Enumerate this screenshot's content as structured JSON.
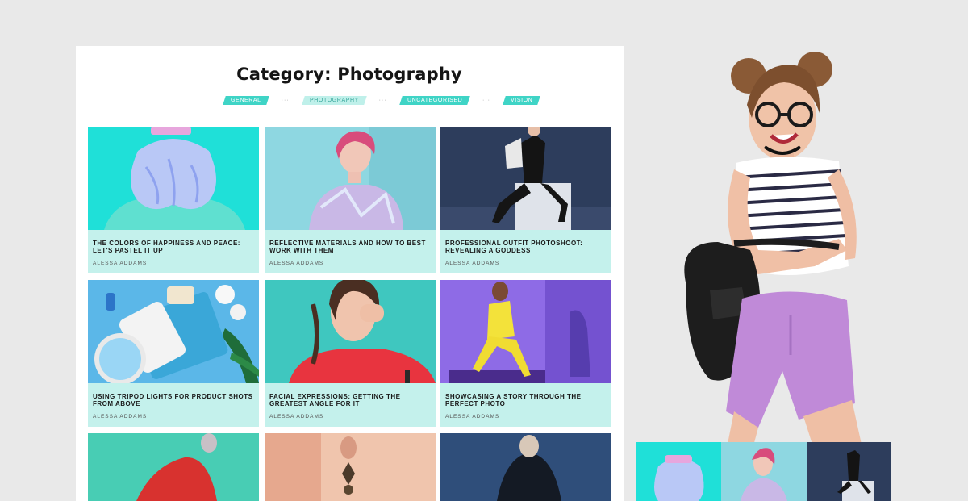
{
  "page": {
    "title": "Category: Photography"
  },
  "categories": [
    {
      "label": "GENERAL",
      "active": false
    },
    {
      "label": "PHOTOGRAPHY",
      "active": true
    },
    {
      "label": "UNCATEGORISED",
      "active": false
    },
    {
      "label": "VISION",
      "active": false
    }
  ],
  "separator": "···",
  "posts": [
    {
      "title": "THE COLORS OF HAPPINESS AND PEACE: LET'S PASTEL IT UP",
      "author": "ALESSA ADDAMS"
    },
    {
      "title": "REFLECTIVE MATERIALS AND HOW TO BEST WORK WITH THEM",
      "author": "ALESSA ADDAMS"
    },
    {
      "title": "PROFESSIONAL OUTFIT PHOTOSHOOT: REVEALING A GODDESS",
      "author": "ALESSA ADDAMS"
    },
    {
      "title": "USING TRIPOD LIGHTS FOR PRODUCT SHOTS FROM ABOVE",
      "author": "ALESSA ADDAMS"
    },
    {
      "title": "FACIAL EXPRESSIONS: GETTING THE GREATEST ANGLE FOR IT",
      "author": "ALESSA ADDAMS"
    },
    {
      "title": "SHOWCASING A STORY THROUGH THE PERFECT PHOTO",
      "author": "ALESSA ADDAMS"
    }
  ],
  "colors": {
    "accent": "#3fd4c6",
    "card_bg": "#c4f1ec"
  }
}
